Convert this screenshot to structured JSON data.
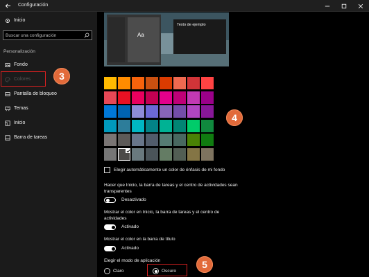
{
  "window": {
    "title": "Configuración"
  },
  "sidebar": {
    "home_label": "Inicio",
    "search_placeholder": "Buscar una configuración",
    "section_label": "Personalización",
    "items": [
      {
        "label": "Fondo",
        "icon": "image-icon"
      },
      {
        "label": "Colores",
        "icon": "palette-icon"
      },
      {
        "label": "Pantalla de bloqueo",
        "icon": "lock-screen-icon"
      },
      {
        "label": "Temas",
        "icon": "brush-icon"
      },
      {
        "label": "Inicio",
        "icon": "start-icon"
      },
      {
        "label": "Barra de tareas",
        "icon": "taskbar-icon"
      }
    ]
  },
  "preview": {
    "tile_text": "Aa",
    "window_text": "Texto de ejemplo"
  },
  "swatches": {
    "rows": [
      [
        "#ffb900",
        "#ff8c00",
        "#f7630c",
        "#ca5010",
        "#da3b01",
        "#ef6950",
        "#d13438",
        "#ff4343"
      ],
      [
        "#e74856",
        "#e81123",
        "#ea005e",
        "#c30052",
        "#e3008c",
        "#bf0077",
        "#c239b3",
        "#9a0089"
      ],
      [
        "#0078d7",
        "#0063b1",
        "#8e8cd8",
        "#6b69d6",
        "#8764b8",
        "#744da9",
        "#b146c2",
        "#881798"
      ],
      [
        "#0099bc",
        "#2d7d9a",
        "#00b7c3",
        "#038387",
        "#00b294",
        "#018574",
        "#00cc6a",
        "#10893e"
      ],
      [
        "#7a7574",
        "#5d5a58",
        "#68768a",
        "#515c6b",
        "#567c73",
        "#486860",
        "#498205",
        "#107c10"
      ],
      [
        "#767676",
        "#4c4a48",
        "#69797e",
        "#4a5459",
        "#647c64",
        "#525e54",
        "#847545",
        "#7e735f"
      ]
    ],
    "selected": [
      5,
      1
    ]
  },
  "settings": {
    "auto_accent_label": "Elegir automáticamente un color de énfasis de mi fondo",
    "transparency_line1": "Hacer que Inicio, la barra de tareas y el centro de actividades sean",
    "transparency_line2": "transparentes",
    "transparency_state": "Desactivado",
    "start_color_line1": "Mostrar el color en Inicio, la barra de tareas y el centro de",
    "start_color_line2": "actividades",
    "start_color_state": "Activado",
    "titlebar_color_label": "Mostrar el color en la barra de título",
    "titlebar_color_state": "Activado",
    "app_mode_label": "Elegir el modo de aplicación",
    "mode_light": "Claro",
    "mode_dark": "Oscuro",
    "selected_mode": "Oscuro"
  },
  "annotations": {
    "step3": "3",
    "step4": "4",
    "step5": "5",
    "color": "#e26a3a"
  }
}
